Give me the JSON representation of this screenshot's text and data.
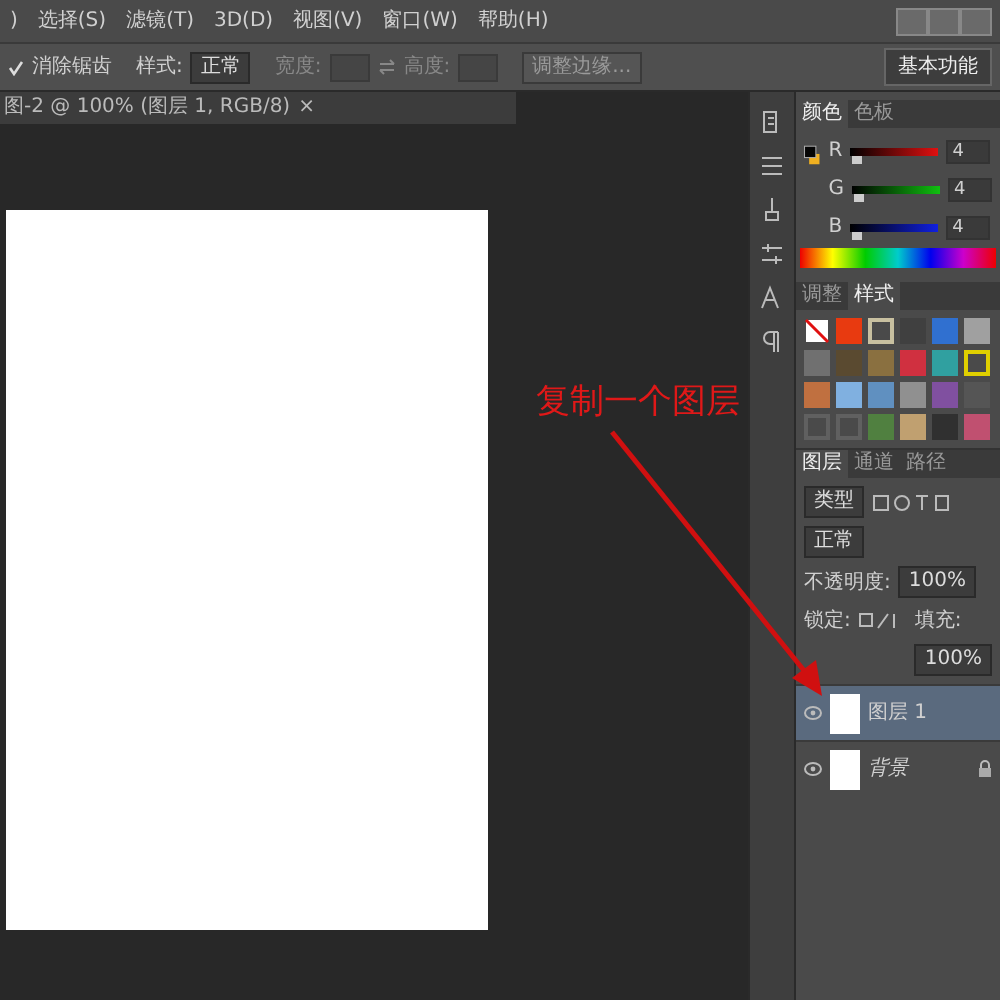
{
  "menu_bar": {
    "items": [
      ")",
      "选择(S)",
      "滤镜(T)",
      "3D(D)",
      "视图(V)",
      "窗口(W)",
      "帮助(H)"
    ]
  },
  "options_bar": {
    "antialias": {
      "label": "消除锯齿",
      "checked": true
    },
    "style_label": "样式:",
    "style_value": "正常",
    "width_label": "宽度:",
    "height_label": "高度:",
    "refine_button": "调整边缘...",
    "workspace": "基本功能"
  },
  "document": {
    "tab_title": "图-2 @ 100% (图层 1, RGB/8)",
    "close": "×"
  },
  "annotation": {
    "text": "复制一个图层"
  },
  "color_panel": {
    "tabs": [
      {
        "label": "颜色",
        "selected": true
      },
      {
        "label": "色板",
        "selected": false
      }
    ],
    "channels": [
      {
        "name": "R",
        "value": "4",
        "level": 0.02
      },
      {
        "name": "G",
        "value": "4",
        "level": 0.02
      },
      {
        "name": "B",
        "value": "4",
        "level": 0.02
      }
    ]
  },
  "styles_panel": {
    "tabs": [
      {
        "label": "调整",
        "selected": false
      },
      {
        "label": "样式",
        "selected": true
      }
    ],
    "styles": [
      {
        "kind": "none"
      },
      {
        "kind": "fill",
        "color": "#e83a10"
      },
      {
        "kind": "frame",
        "color": "#c8c0a0"
      },
      {
        "kind": "fill",
        "color": "#404040"
      },
      {
        "kind": "fill",
        "color": "#3070d0"
      },
      {
        "kind": "fill",
        "color": "#a0a0a0"
      },
      {
        "kind": "fill",
        "color": "#707070"
      },
      {
        "kind": "fill",
        "color": "#5a4a30"
      },
      {
        "kind": "fill",
        "color": "#8a7040"
      },
      {
        "kind": "fill",
        "color": "#d03040"
      },
      {
        "kind": "fill",
        "color": "#30a0a0"
      },
      {
        "kind": "frame",
        "color": "#e0d000"
      },
      {
        "kind": "fill",
        "color": "#c07040"
      },
      {
        "kind": "fill",
        "color": "#80b0e0"
      },
      {
        "kind": "fill",
        "color": "#6090c0"
      },
      {
        "kind": "fill",
        "color": "#909090"
      },
      {
        "kind": "fill",
        "color": "#8050a0"
      },
      {
        "kind": "fill",
        "color": "#555555"
      },
      {
        "kind": "frame",
        "color": "#606060"
      },
      {
        "kind": "frame",
        "color": "#606060"
      },
      {
        "kind": "fill",
        "color": "#508040"
      },
      {
        "kind": "fill",
        "color": "#c0a070"
      },
      {
        "kind": "fill",
        "color": "#303030"
      },
      {
        "kind": "fill",
        "color": "#c05070"
      }
    ]
  },
  "layers_panel": {
    "tabs": [
      {
        "label": "图层",
        "selected": true
      },
      {
        "label": "通道",
        "selected": false
      },
      {
        "label": "路径",
        "selected": false
      }
    ],
    "filter": "类型",
    "blend_mode": "正常",
    "opacity_label": "不透明度:",
    "opacity_value": "100%",
    "lock_label": "锁定:",
    "fill_label": "填充:",
    "fill_value": "100%",
    "layers": [
      {
        "name": "图层 1",
        "kind": "normal",
        "visible": true,
        "selected": true,
        "locked": false
      },
      {
        "name": "背景",
        "kind": "background",
        "visible": true,
        "selected": false,
        "locked": true
      }
    ]
  }
}
